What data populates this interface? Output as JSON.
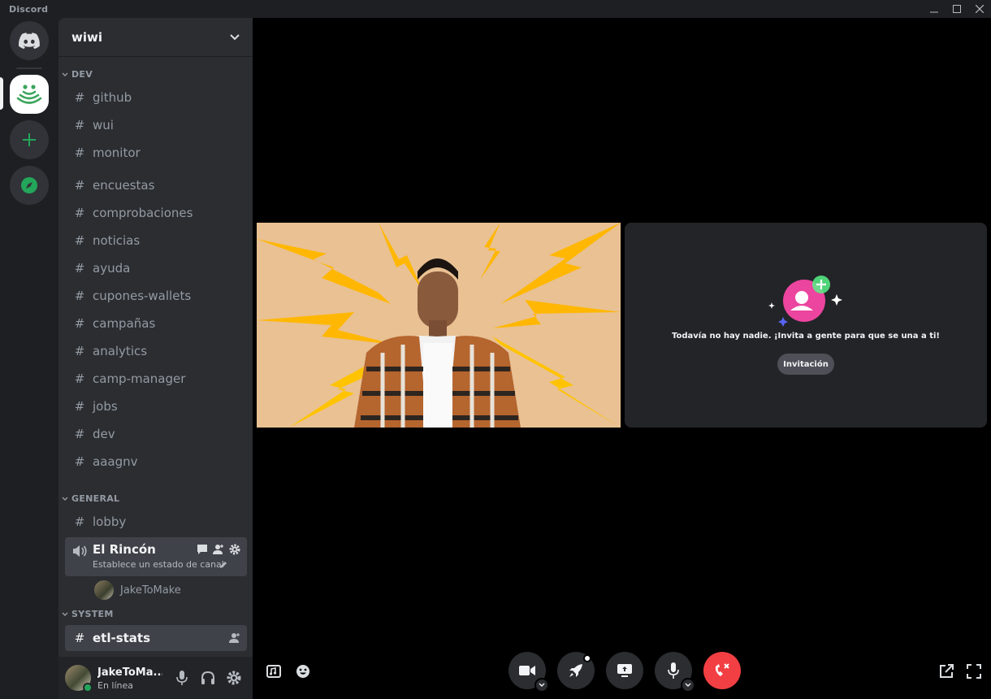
{
  "app": {
    "title": "Discord"
  },
  "server": {
    "name": "wiwi"
  },
  "categories": [
    {
      "name": "DEV",
      "channels": [
        "github",
        "wui",
        "monitor",
        "encuestas",
        "comprobaciones",
        "noticias",
        "ayuda",
        "cupones-wallets",
        "campañas",
        "analytics",
        "camp-manager",
        "jobs",
        "dev",
        "aaagnv"
      ]
    },
    {
      "name": "GENERAL",
      "channels": [
        "lobby"
      ]
    },
    {
      "name": "SYSTEM",
      "channels": [
        "etl-stats"
      ]
    }
  ],
  "voice_channel": {
    "name": "El Rincón",
    "status": "Establece un estado de canal",
    "members": [
      "JakeToMake"
    ]
  },
  "user": {
    "name": "JakeToMa...",
    "status": "En línea"
  },
  "stage": {
    "empty_message": "Todavía no hay nadie. ¡Invita a gente para que se una a ti!",
    "invite_label": "Invitación"
  },
  "colors": {
    "accent": "#23a55a",
    "danger": "#f23f43",
    "invite_pink": "#eb459f"
  }
}
